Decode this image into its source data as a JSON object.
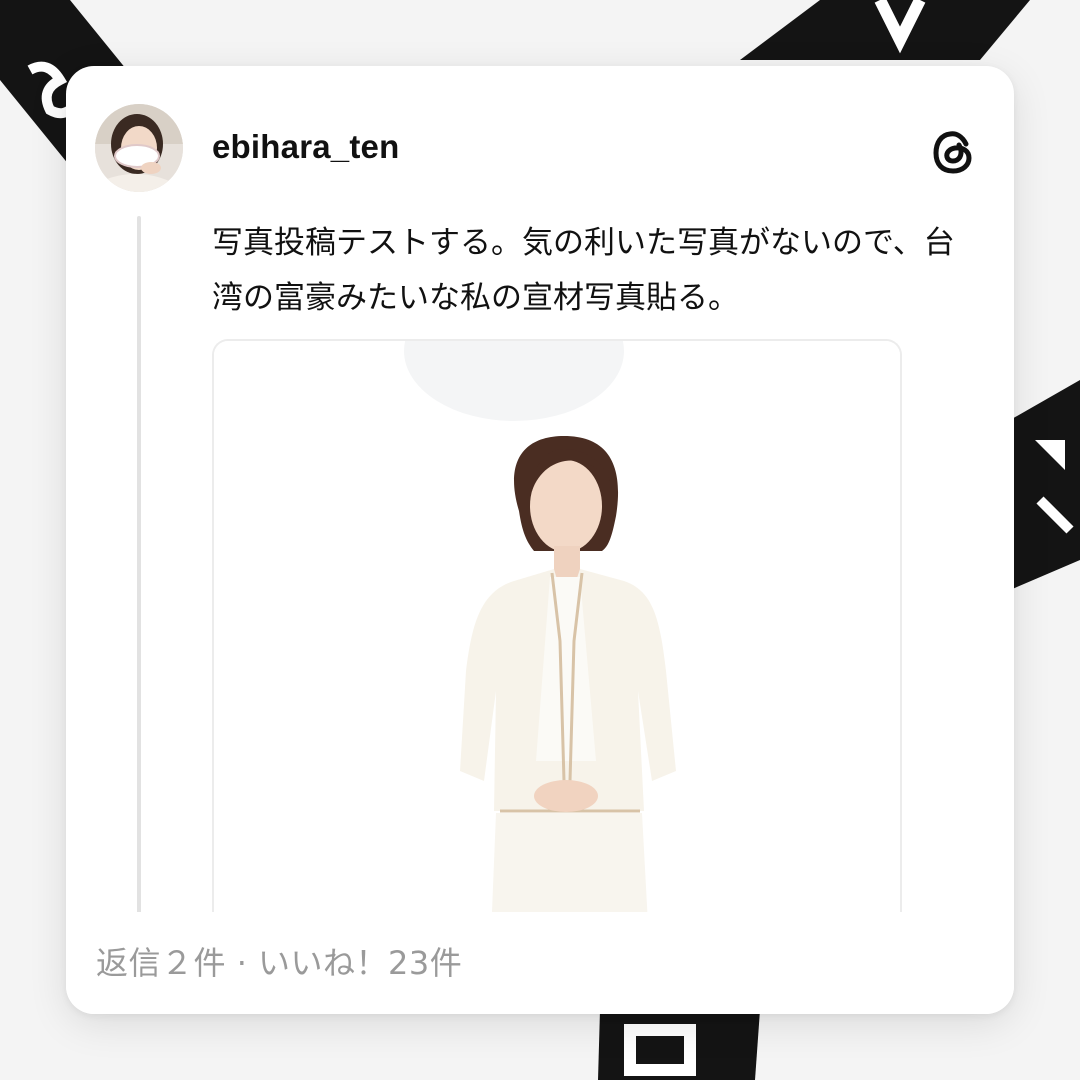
{
  "post": {
    "username": "ebihara_ten",
    "text": "写真投稿テストする。気の利いた写真がないので、台湾の富豪みたいな私の宣材写真貼る。",
    "replies_label": "返信２件",
    "separator": "·",
    "likes_label": "いいね！23件"
  },
  "icons": {
    "avatar": "profile-photo",
    "brand": "threads-logo-icon"
  },
  "colors": {
    "card": "#ffffff",
    "text": "#111111",
    "muted": "#9a9a9a",
    "thread_line": "#e2e2e2"
  }
}
